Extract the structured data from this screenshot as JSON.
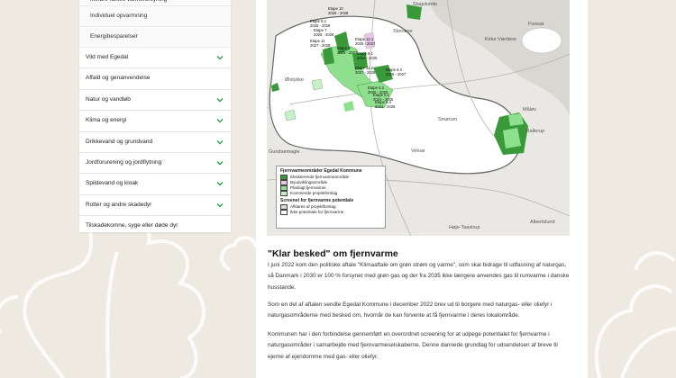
{
  "sidebar": {
    "sub_items": [
      {
        "label": "Mindre fælles varmeforsyning"
      },
      {
        "label": "Individuel opvarmning"
      },
      {
        "label": "Energibesparelser"
      }
    ],
    "items": [
      {
        "label": "Vild med Egedal",
        "has_chevron": true
      },
      {
        "label": "Affald og genanvendelse",
        "has_chevron": false
      },
      {
        "label": "Natur og vandløb",
        "has_chevron": true
      },
      {
        "label": "Klima og energi",
        "has_chevron": true
      },
      {
        "label": "Drikkevand og grundvand",
        "has_chevron": true
      },
      {
        "label": "Jordforurening og jordflytning",
        "has_chevron": true
      },
      {
        "label": "Spildevand og kloak",
        "has_chevron": true
      },
      {
        "label": "Rotter og andre skadedyr",
        "has_chevron": true
      },
      {
        "label": "Tilskadekomne, syge eller døde dyr",
        "has_chevron": false
      }
    ],
    "accent_color": "#2e9e4a"
  },
  "map": {
    "places": {
      "slagslunde": "Slagslunde",
      "furesoe": "Furesø",
      "kirke_vaerloese": "Kirke Værløse",
      "maalov": "Måløv",
      "ballerup": "Ballerup",
      "gundsomagle": "Gundsømagle",
      "albertslund": "Albertslund",
      "hoeje_taastrup": "Høje-Taastrup",
      "slagslunde_small": "Slagslunde",
      "oelstykke": "Ølstykke",
      "smorum": "Smørum",
      "veksoe": "Veksø",
      "stenloese": "Stenløse"
    },
    "etapes": [
      {
        "label": "Etape 10\n2026 - 2028"
      },
      {
        "label": "Etape 8.2\n2025 - 2026"
      },
      {
        "label": "Etape 7\n2025 - 2026"
      },
      {
        "label": "Etape 11\n2027 - 2028"
      },
      {
        "label": "Etape 12.1\n2025 - 2027"
      },
      {
        "label": "Etape 9\n2025 - 2027"
      },
      {
        "label": "Etape 8.1\n2024 - 2025"
      },
      {
        "label": "Etape 11.2\n2027 - 2028"
      },
      {
        "label": "Etape 6.3\n2026 - 2027"
      },
      {
        "label": "Etape 6.2\n2025 - 2026"
      },
      {
        "label": "Etape 5.1\n2024 - 2025"
      },
      {
        "label": "Etape 9.4\n2024 - 2025"
      }
    ],
    "legend": {
      "title": "Fjernvarmeområder Egedal Kommune",
      "entries": [
        {
          "label": "Eksisterende fjernvarmeområde",
          "color": "#3a9a3a"
        },
        {
          "label": "Byudviklingsområde",
          "color": "#e6c8e6"
        },
        {
          "label": "Planlagt fjernvarme",
          "color": "#8ee08e"
        },
        {
          "label": "Kommende projektforslag",
          "color": "#c8f0c8"
        }
      ],
      "subtitle": "Screenet for fjernvarme potentiale",
      "entries2": [
        {
          "label": "Afklares af projektforslag",
          "color": "#d8d8d8"
        },
        {
          "label": "Ikke potentiale for fjernvarme",
          "color": "#ffffff"
        }
      ]
    }
  },
  "article": {
    "heading": "\"Klar besked\" om fjernvarme",
    "paragraphs": [
      "I juni 2022 kom den politiske aftale \"Klimaaftale om grøn strøm og varme\", som skal bidrage til udfasning af naturgas, så Danmark i 2030 er 100 % forsynet med grøn gas og der fra 2035 ikke længere anvendes gas til rumvarme i danske husstande.",
      "Som en del af aftalen sendte Egedal Kommune i december 2022 brev ud til borgere med naturgas- eller oliefyr i naturgasområderne med besked om, hvornår de kan forvente at få fjernvarme i deres lokalområde.",
      "Kommunen har i den forbindelse gennemført en overordnet screening for at udpege potentialet for fjernvarme i naturgasområder i samarbejde med fjernvarmeselskaberne. Denne dannede grundlag for udsendelsen af breve til ejerne af ejendomme med gas- eller oliefyr."
    ]
  }
}
